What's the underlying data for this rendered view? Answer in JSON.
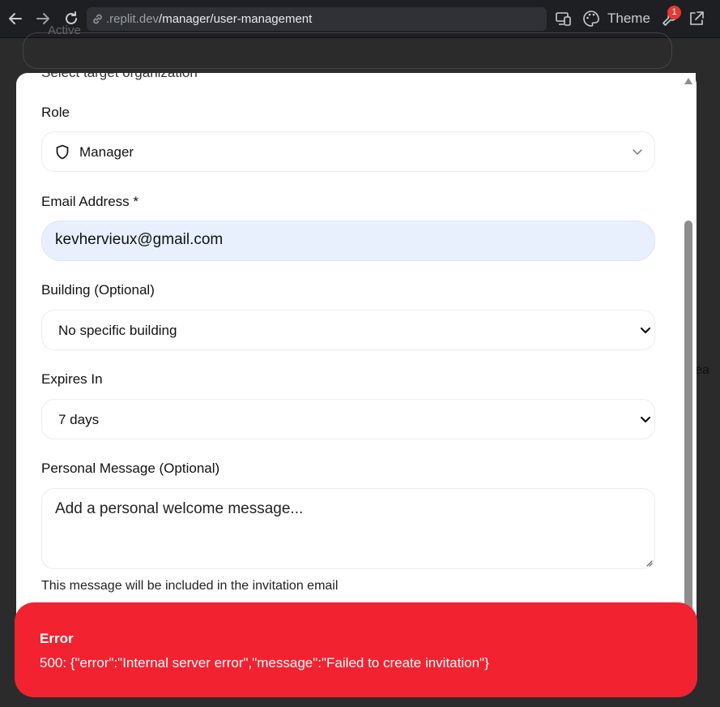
{
  "browser": {
    "url_host": ".replit.dev",
    "url_path": "/manager/user-management",
    "theme_label": "Theme",
    "notification_count": "1"
  },
  "background": {
    "card_text": "Active",
    "right_text": "ea"
  },
  "dialog": {
    "cut_off_text": "Select target organization",
    "role": {
      "label": "Role",
      "value": "Manager"
    },
    "email": {
      "label": "Email Address *",
      "value": "kevhervieux@gmail.com"
    },
    "building": {
      "label": "Building (Optional)",
      "value": "No specific building"
    },
    "expires": {
      "label": "Expires In",
      "value": "7 days"
    },
    "message": {
      "label": "Personal Message (Optional)",
      "placeholder": "Add a personal welcome message...",
      "helper": "This message will be included in the invitation email"
    }
  },
  "toast": {
    "title": "Error",
    "message": "500: {\"error\":\"Internal server error\",\"message\":\"Failed to create invitation\"}",
    "color": "#f22230"
  },
  "icons": {
    "back": "arrow-left-icon",
    "forward": "arrow-right-icon",
    "reload": "reload-icon",
    "link": "link-icon",
    "devices": "devices-icon",
    "palette": "palette-icon",
    "wrench": "wrench-icon",
    "open_external": "open-external-icon",
    "role_shield": "shield-icon",
    "chevron": "chevron-down-icon"
  }
}
